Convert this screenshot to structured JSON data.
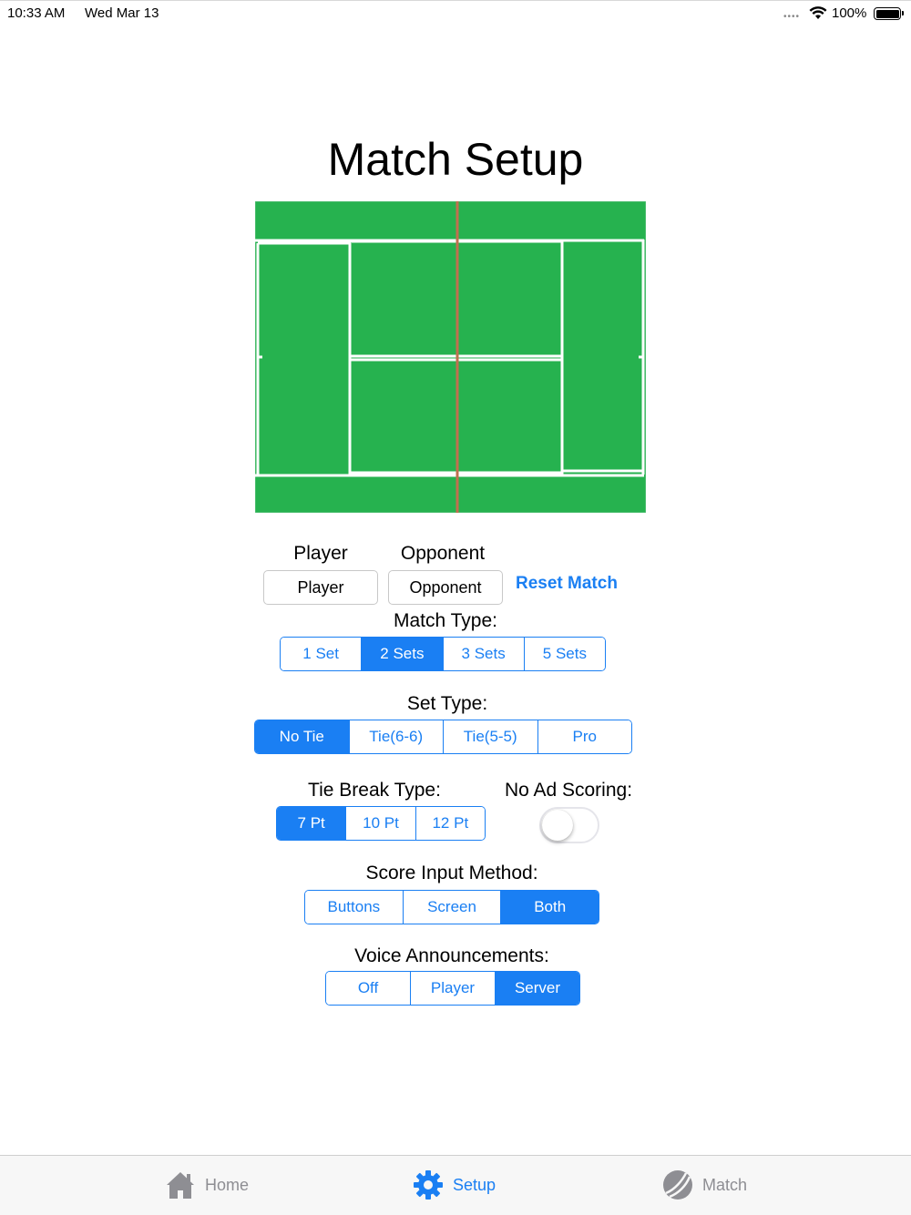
{
  "status_bar": {
    "time": "10:33 AM",
    "date": "Wed Mar 13",
    "battery": "100%"
  },
  "title": "Match Setup",
  "players": {
    "player_label": "Player",
    "opponent_label": "Opponent",
    "player_value": "Player",
    "opponent_value": "Opponent",
    "reset_label": "Reset Match"
  },
  "match_type": {
    "label": "Match Type:",
    "options": [
      "1 Set",
      "2 Sets",
      "3 Sets",
      "5 Sets"
    ],
    "selected": "2 Sets"
  },
  "set_type": {
    "label": "Set Type:",
    "options": [
      "No Tie",
      "Tie(6-6)",
      "Tie(5-5)",
      "Pro"
    ],
    "selected": "No Tie"
  },
  "tie_break_type": {
    "label": "Tie Break Type:",
    "options": [
      "7 Pt",
      "10 Pt",
      "12 Pt"
    ],
    "selected": "7 Pt"
  },
  "no_ad_scoring": {
    "label": "No Ad Scoring:",
    "enabled": false
  },
  "score_input": {
    "label": "Score Input Method:",
    "options": [
      "Buttons",
      "Screen",
      "Both"
    ],
    "selected": "Both"
  },
  "voice": {
    "label": "Voice Announcements:",
    "options": [
      "Off",
      "Player",
      "Server"
    ],
    "selected": "Server"
  },
  "tab_bar": {
    "tabs": [
      {
        "label": "Home",
        "icon": "house-icon"
      },
      {
        "label": "Setup",
        "icon": "gear-icon"
      },
      {
        "label": "Match",
        "icon": "tennis-ball-icon"
      }
    ],
    "active": "Setup"
  },
  "colors": {
    "accent": "#1a7ff3",
    "court_green": "#26b24f",
    "net": "#c1704f",
    "court_line": "#ffffff"
  }
}
